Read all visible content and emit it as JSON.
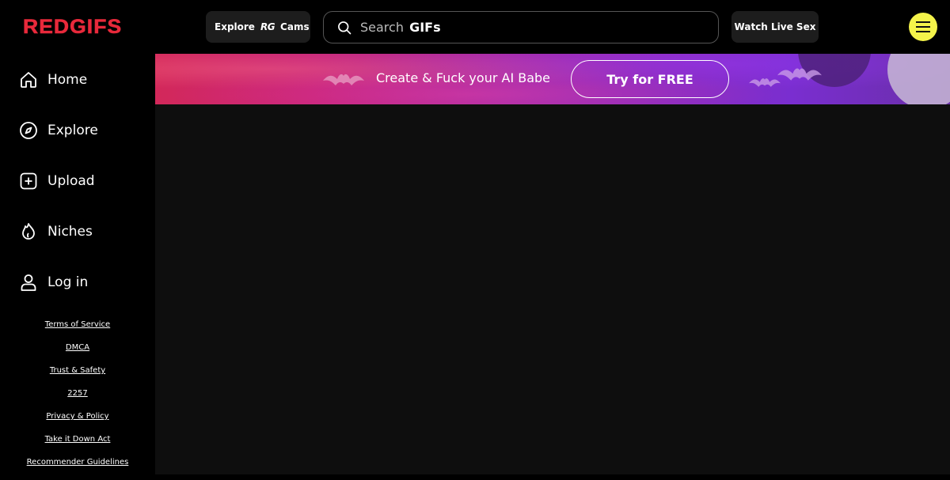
{
  "header": {
    "logo": "REDGIFS",
    "explore_cams": {
      "explore": "Explore",
      "rg": "RG",
      "cams": "Cams"
    },
    "search": {
      "placeholder_prefix": "Search",
      "placeholder_emphasis": "GIFs"
    },
    "watch_live": "Watch Live Sex",
    "menu_icon": "hamburger-icon"
  },
  "sidebar": {
    "items": [
      {
        "label": "Home",
        "icon": "home-icon"
      },
      {
        "label": "Explore",
        "icon": "compass-icon"
      },
      {
        "label": "Upload",
        "icon": "plus-square-icon"
      },
      {
        "label": "Niches",
        "icon": "flame-icon"
      },
      {
        "label": "Log in",
        "icon": "user-icon"
      }
    ],
    "footer_links": [
      "Terms of Service",
      "DMCA",
      "Trust & Safety",
      "2257",
      "Privacy & Policy",
      "Take it Down Act",
      "Recommender Guidelines"
    ]
  },
  "banner": {
    "text": "Create & Fuck your AI Babe",
    "cta": "Try for FREE"
  },
  "colors": {
    "brand": "#e8293b",
    "menu_button": "#f4f34a",
    "background": "#000000"
  }
}
